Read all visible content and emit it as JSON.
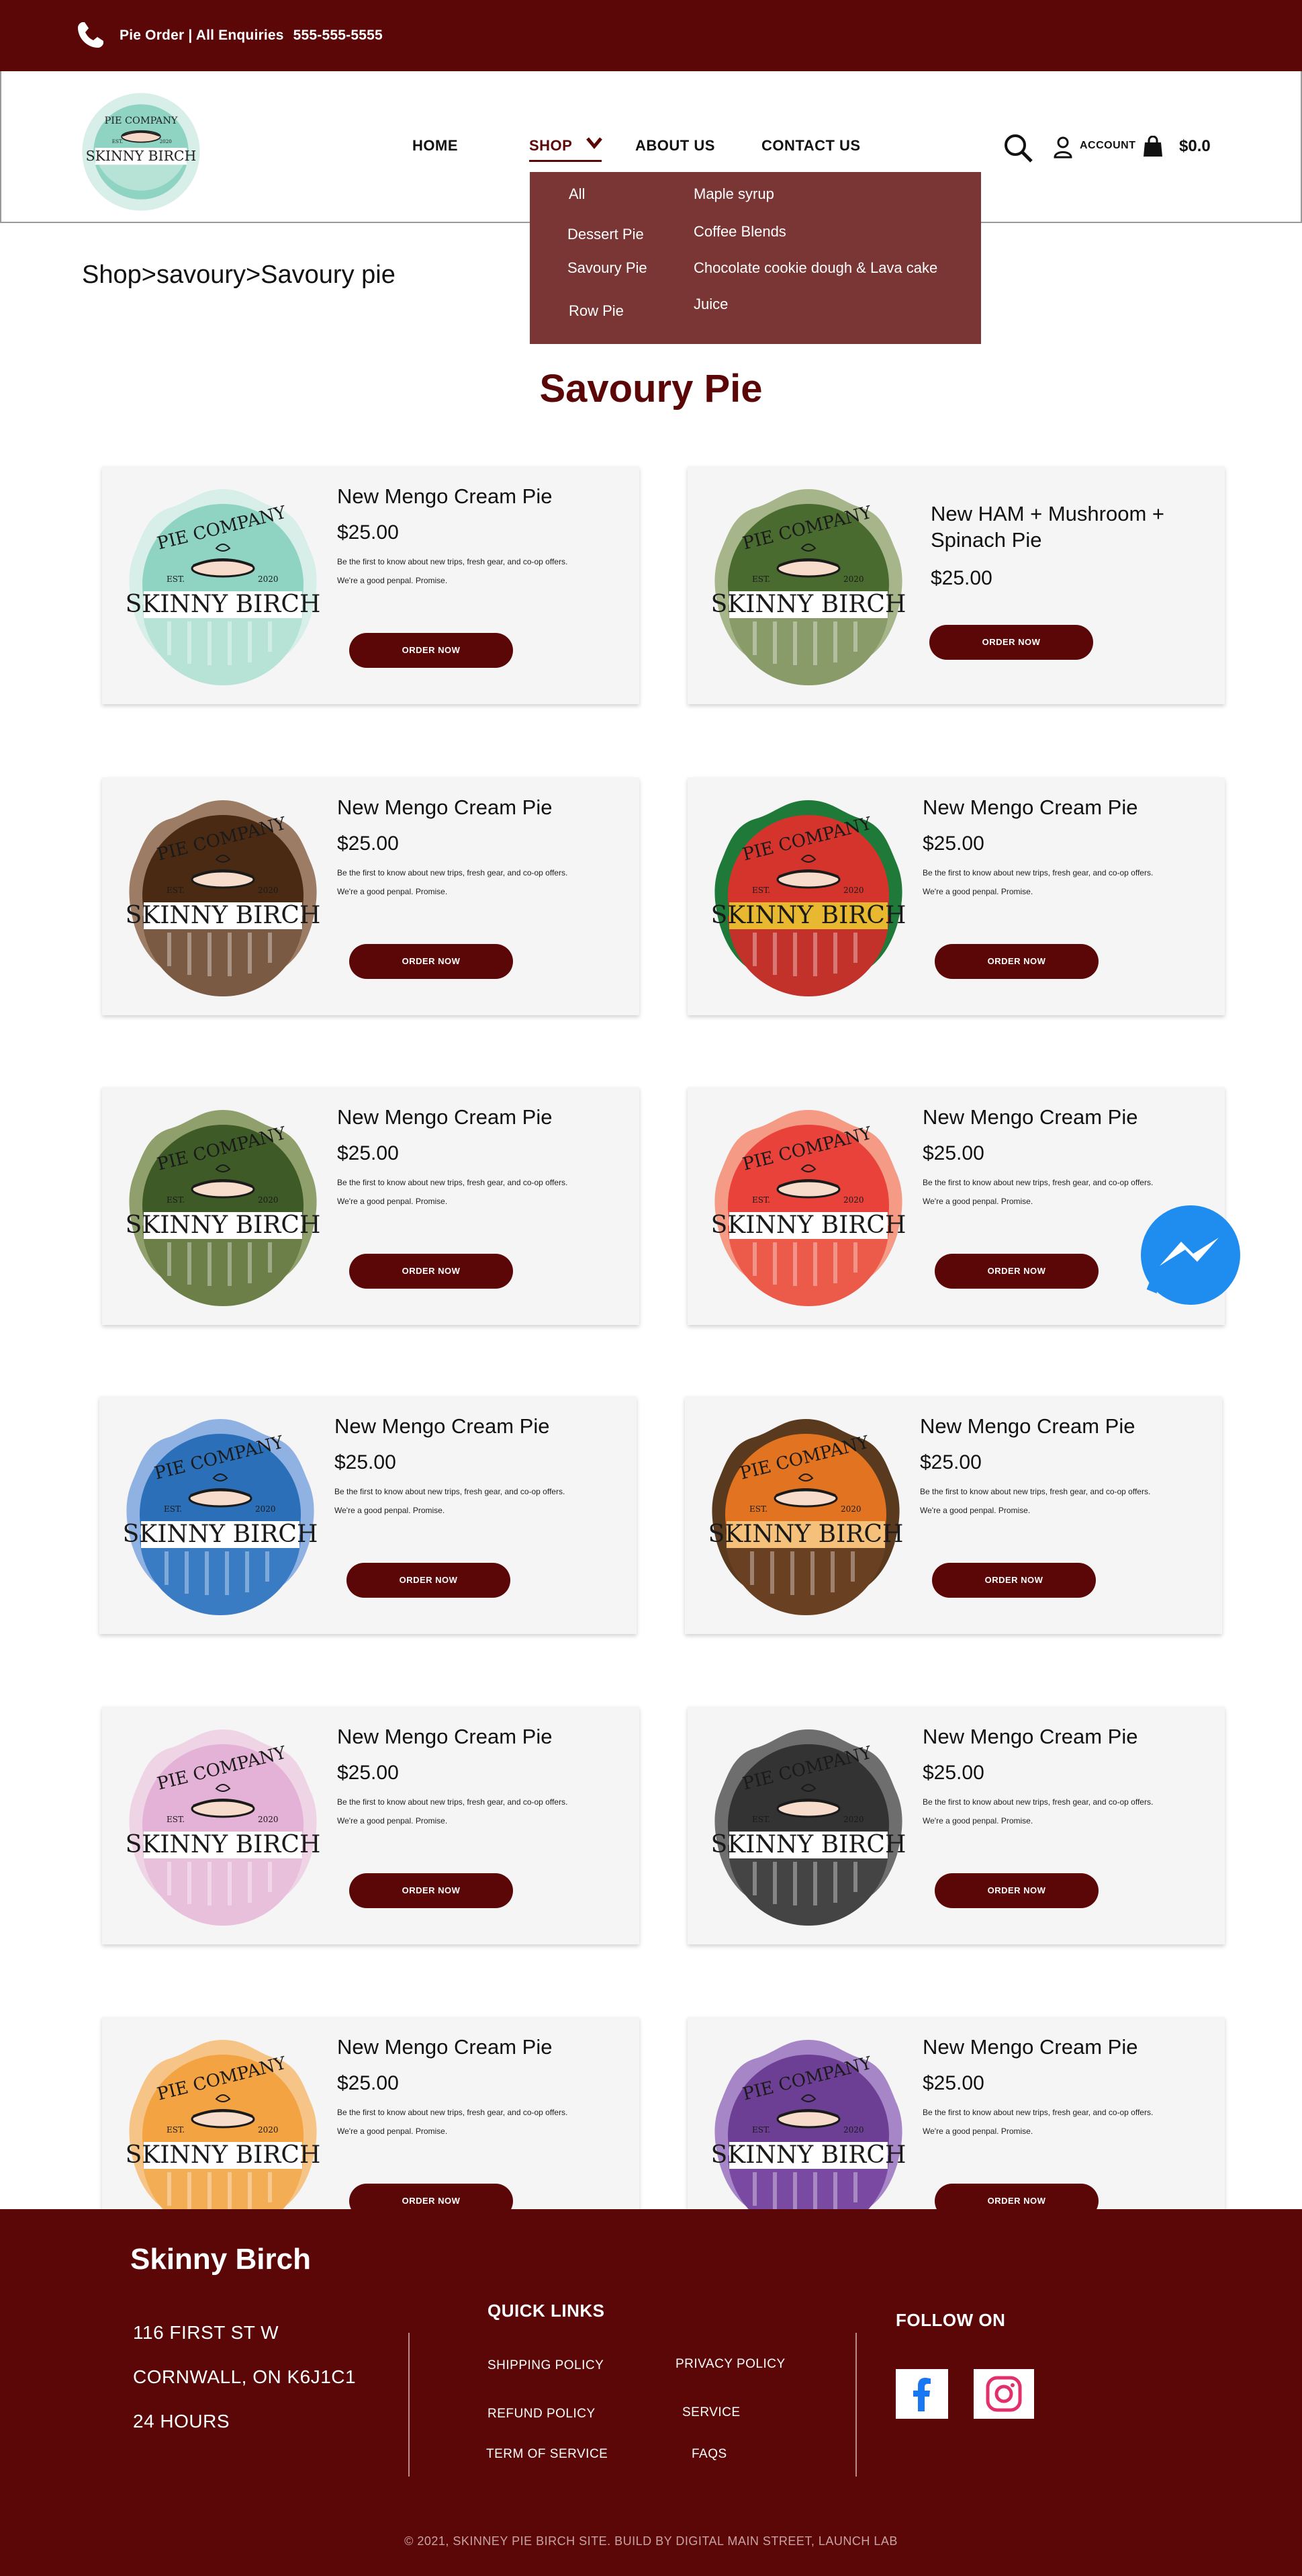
{
  "topbar": {
    "text": "Pie Order | All Enquiries",
    "phone": "555-555-5555"
  },
  "header": {
    "logo": {
      "line1": "PIE COMPANY",
      "line2": "SKINNY BIRCH",
      "est": "EST.",
      "year": "2020"
    },
    "nav": {
      "home": "HOME",
      "shop": "SHOP",
      "about": "ABOUT US",
      "contact": "CONTACT US"
    },
    "account_label": "ACCOUNT",
    "cart_total": "$0.0"
  },
  "dropdown": {
    "left": [
      "All",
      "Dessert Pie",
      "Savoury Pie",
      "Row Pie"
    ],
    "right": [
      "Maple syrup",
      "Coffee Blends",
      "Chocolate cookie dough & Lava cake",
      "Juice"
    ]
  },
  "breadcrumb": "Shop>savoury>Savoury pie",
  "page_title": "Savoury Pie",
  "products": [
    {
      "name": "New Mengo Cream Pie",
      "price": "$25.00",
      "desc1": "Be the first to know about new trips, fresh gear, and co-op offers.",
      "desc2": "We're a good penpal. Promise.",
      "button": "ORDER NOW",
      "colors": {
        "top": "#8fd3c2",
        "bottom": "#b6e3d6",
        "frame": "#d7efe8"
      }
    },
    {
      "name": "New HAM + Mushroom + Spinach Pie",
      "price": "$25.00",
      "desc1": "",
      "desc2": "",
      "button": "ORDER NOW",
      "colors": {
        "top": "#4a6b2f",
        "bottom": "#8a9b6a",
        "frame": "#a7b58a"
      }
    },
    {
      "name": "New Mengo Cream Pie",
      "price": "$25.00",
      "desc1": "Be the first to know about new trips, fresh gear, and co-op offers.",
      "desc2": "We're a good penpal. Promise.",
      "button": "ORDER NOW",
      "colors": {
        "top": "#4a2a12",
        "bottom": "#7a5a42",
        "frame": "#9c7c64"
      }
    },
    {
      "name": "New Mengo Cream Pie",
      "price": "$25.00",
      "desc1": "Be the first to know about new trips, fresh gear, and co-op offers.",
      "desc2": "We're a good penpal. Promise.",
      "button": "ORDER NOW",
      "colors": {
        "top": "#d4342b",
        "bottom": "#c2312a",
        "frame": "#1f7a3a",
        "band": "#e8b830"
      }
    },
    {
      "name": "New Mengo Cream Pie",
      "price": "$25.00",
      "desc1": "Be the first to know about new trips, fresh gear, and co-op offers.",
      "desc2": "We're a good penpal. Promise.",
      "button": "ORDER NOW",
      "colors": {
        "top": "#3d5a27",
        "bottom": "#6c7f49",
        "frame": "#8fa06c"
      }
    },
    {
      "name": "New Mengo Cream Pie",
      "price": "$25.00",
      "desc1": "Be the first to know about new trips, fresh gear, and co-op offers.",
      "desc2": "We're a good penpal. Promise.",
      "button": "ORDER NOW",
      "colors": {
        "top": "#e8423a",
        "bottom": "#ec5a4a",
        "frame": "#f59a84"
      }
    },
    {
      "name": "New Mengo Cream Pie",
      "price": "$25.00",
      "desc1": "Be the first to know about new trips, fresh gear, and co-op offers.",
      "desc2": "We're a good penpal. Promise.",
      "button": "ORDER NOW",
      "colors": {
        "top": "#2a6fb8",
        "bottom": "#3a7cc4",
        "frame": "#8fb2e3"
      }
    },
    {
      "name": "New Mengo Cream Pie",
      "price": "$25.00",
      "desc1": "Be the first to know about new trips, fresh gear, and co-op offers.",
      "desc2": "We're a good penpal. Promise.",
      "button": "ORDER NOW",
      "colors": {
        "top": "#e27320",
        "bottom": "#6a4022",
        "frame": "#5a3a1e",
        "band": "#f4c07a"
      }
    },
    {
      "name": "New Mengo Cream Pie",
      "price": "$25.00",
      "desc1": "Be the first to know about new trips, fresh gear, and co-op offers.",
      "desc2": "We're a good penpal. Promise.",
      "button": "ORDER NOW",
      "colors": {
        "top": "#e3b2d6",
        "bottom": "#e8c0dc",
        "frame": "#efd4e6"
      }
    },
    {
      "name": "New Mengo Cream Pie",
      "price": "$25.00",
      "desc1": "Be the first to know about new trips, fresh gear, and co-op offers.",
      "desc2": "We're a good penpal. Promise.",
      "button": "ORDER NOW",
      "colors": {
        "top": "#333333",
        "bottom": "#444444",
        "frame": "#6e6e6e"
      }
    },
    {
      "name": "New Mengo Cream Pie",
      "price": "$25.00",
      "desc1": "Be the first to know about new trips, fresh gear, and co-op offers.",
      "desc2": "We're a good penpal. Promise.",
      "button": "ORDER NOW",
      "colors": {
        "top": "#f3a341",
        "bottom": "#f3ad55",
        "frame": "#f6c486"
      }
    },
    {
      "name": "New Mengo Cream Pie",
      "price": "$25.00",
      "desc1": "Be the first to know about new trips, fresh gear, and co-op offers.",
      "desc2": "We're a good penpal. Promise.",
      "button": "ORDER NOW",
      "colors": {
        "top": "#6c3f95",
        "bottom": "#7a4aa2",
        "frame": "#a786c8"
      }
    }
  ],
  "footer": {
    "brand": "Skinny Birch",
    "address1": "116 FIRST ST W",
    "address2": "CORNWALL, ON K6J1C1",
    "hours": "24 HOURS",
    "quick_links_title": "QUICK LINKS",
    "links": [
      "SHIPPING POLICY",
      "PRIVACY POLICY",
      "REFUND POLICY",
      "SERVICE",
      "TERM OF SERVICE",
      "FAQS"
    ],
    "follow_title": "FOLLOW ON",
    "copyright": "© 2021, SKINNEY PIE BIRCH SITE. BUILD BY DIGITAL MAIN STREET, LAUNCH LAB"
  },
  "colors": {
    "brand": "#5b0707",
    "dropdown_bg": "#7a3535",
    "card_bg": "#f5f5f5",
    "messenger": "#1f8cf0",
    "facebook": "#1877f2",
    "instagram": "#e1306c"
  },
  "icons": [
    "phone-icon",
    "chevron-down-icon",
    "search-icon",
    "user-icon",
    "shopping-bag-icon",
    "messenger-icon",
    "facebook-icon",
    "instagram-icon"
  ]
}
